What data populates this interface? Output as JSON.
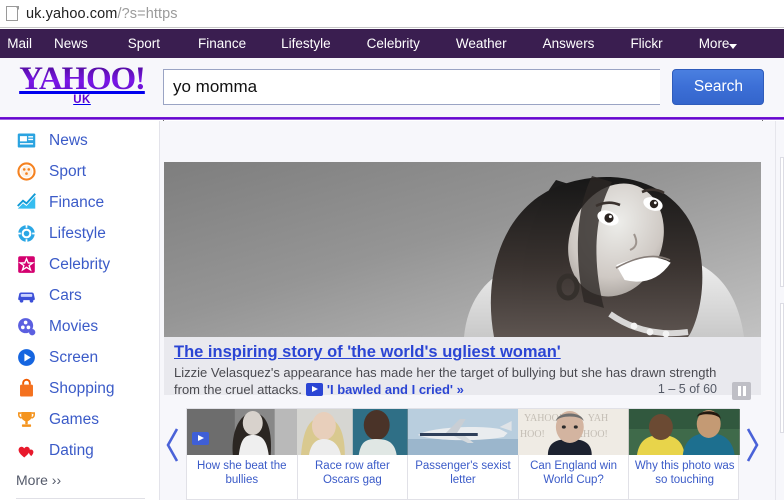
{
  "browser": {
    "url_main": "uk.yahoo.com",
    "url_query": "/?s=https",
    "page_icon": "page-icon"
  },
  "topnav": {
    "items": [
      {
        "label": "Mail",
        "name": "nav-mail"
      },
      {
        "label": "News",
        "name": "nav-news"
      },
      {
        "label": "Sport",
        "name": "nav-sport"
      },
      {
        "label": "Finance",
        "name": "nav-finance"
      },
      {
        "label": "Lifestyle",
        "name": "nav-lifestyle"
      },
      {
        "label": "Celebrity",
        "name": "nav-celebrity"
      },
      {
        "label": "Weather",
        "name": "nav-weather"
      },
      {
        "label": "Answers",
        "name": "nav-answers"
      },
      {
        "label": "Flickr",
        "name": "nav-flickr"
      },
      {
        "label": "More",
        "name": "nav-more"
      }
    ],
    "background": "#3a1e50",
    "text_color": "#ffffff"
  },
  "masthead": {
    "logo": "YAHOO!",
    "logo_sub": "UK",
    "logo_color": "#5f01d1",
    "search": {
      "value": "yo momma",
      "placeholder": "Search",
      "button_label": "Search",
      "button_color": "#3c6fd6"
    }
  },
  "sidebar": {
    "items": [
      {
        "label": "News",
        "icon": "newspaper-icon"
      },
      {
        "label": "Sport",
        "icon": "football-icon"
      },
      {
        "label": "Finance",
        "icon": "chart-line-icon"
      },
      {
        "label": "Lifestyle",
        "icon": "gem-icon"
      },
      {
        "label": "Celebrity",
        "icon": "star-badge-icon"
      },
      {
        "label": "Cars",
        "icon": "car-icon"
      },
      {
        "label": "Movies",
        "icon": "film-reel-icon"
      },
      {
        "label": "Screen",
        "icon": "play-circle-icon"
      },
      {
        "label": "Shopping",
        "icon": "shopping-bag-icon"
      },
      {
        "label": "Games",
        "icon": "trophy-icon"
      },
      {
        "label": "Dating",
        "icon": "hearts-icon"
      }
    ],
    "more_label": "More ››",
    "link_color": "#3b5bc8"
  },
  "hero": {
    "title": "The inspiring story of 'the world's ugliest woman'",
    "description_line1": "Lizzie Velasquez's appearance has made her the target of bullying but she has drawn strength",
    "description_line2": "from the cruel attacks.",
    "video_link": "'I bawled and I cried' »",
    "slide_count": "1 – 5 of 60",
    "pause_label": "pause-icon",
    "image_alt": "black and white portrait of a smiling woman with long dark hair"
  },
  "carousel": {
    "prev_label": "previous-arrow",
    "next_label": "next-arrow",
    "thumbs": [
      {
        "caption": "How she beat the bullies",
        "has_video": true,
        "alt": "woman in black and white portrait"
      },
      {
        "caption": "Race row after Oscars gag",
        "has_video": false,
        "alt": "two women, blonde presenter and actress"
      },
      {
        "caption": "Passenger's sexist letter",
        "has_video": false,
        "alt": "commercial airliner in flight"
      },
      {
        "caption": "Can England win World Cup?",
        "has_video": false,
        "alt": "football manager in front of yahoo backdrop"
      },
      {
        "caption": "Why this photo was so touching",
        "has_video": false,
        "alt": "footballer with young boy"
      }
    ]
  }
}
